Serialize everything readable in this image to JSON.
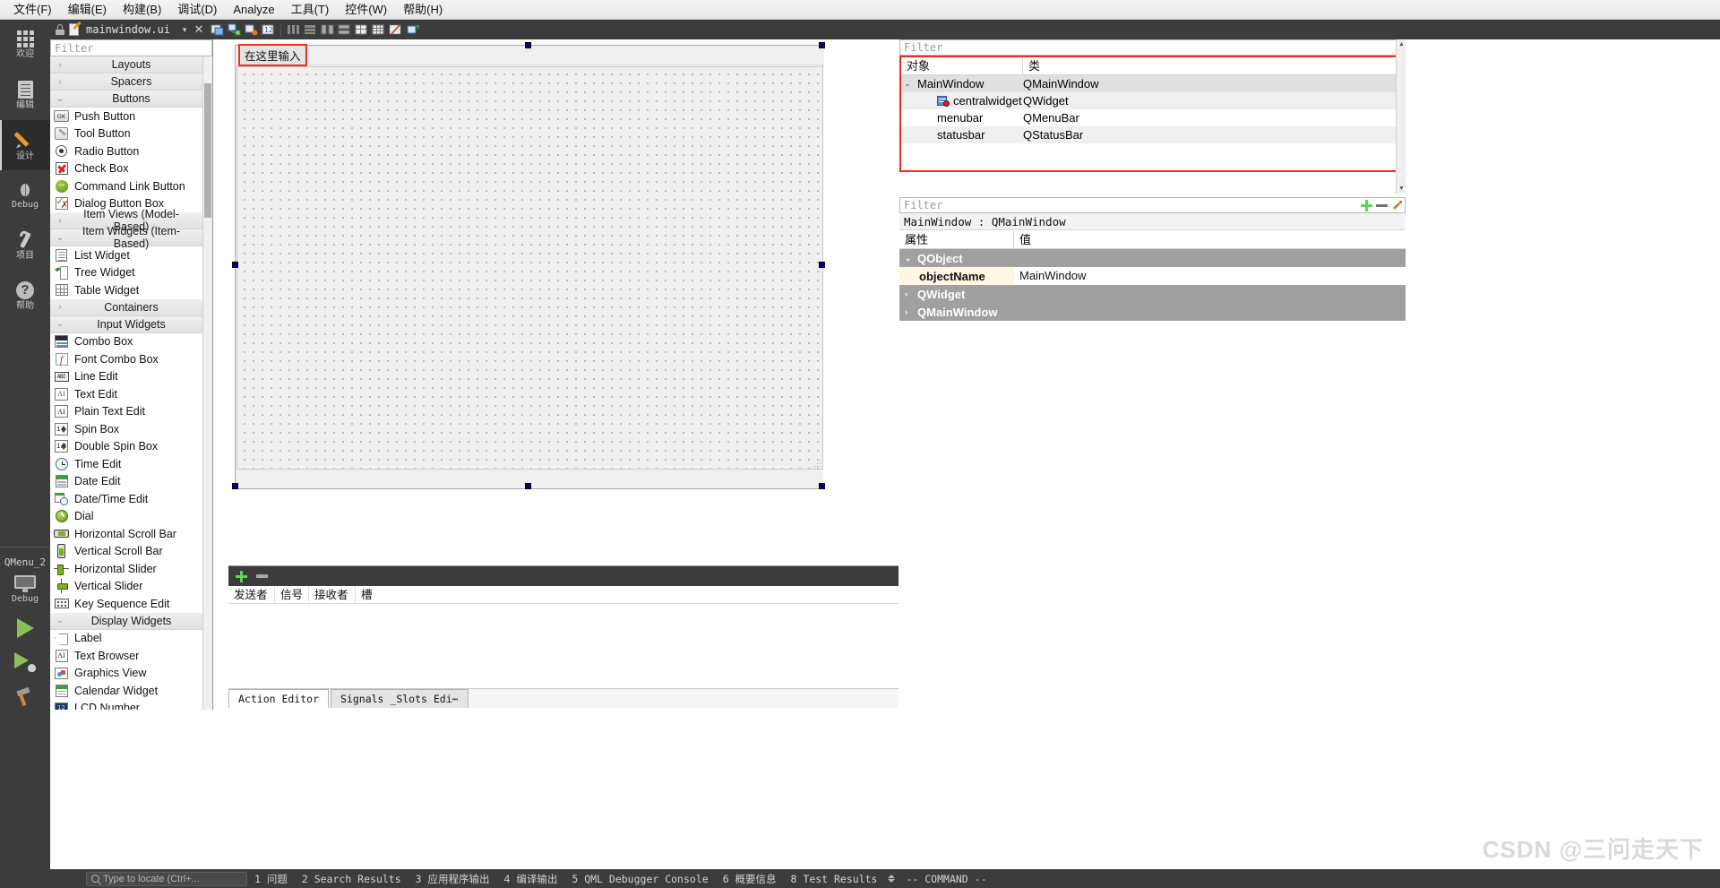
{
  "menubar": {
    "items": [
      "文件(F)",
      "编辑(E)",
      "构建(B)",
      "调试(D)",
      "Analyze",
      "工具(T)",
      "控件(W)",
      "帮助(H)"
    ]
  },
  "modebar": {
    "items": [
      {
        "label": "欢迎",
        "icon": "grid-icon"
      },
      {
        "label": "编辑",
        "icon": "document-icon"
      },
      {
        "label": "设计",
        "icon": "pencil-icon"
      },
      {
        "label": "Debug",
        "icon": "bug-icon"
      },
      {
        "label": "项目",
        "icon": "wrench-icon"
      },
      {
        "label": "帮助",
        "icon": "question-icon"
      }
    ],
    "kit_label": "QMenu_2",
    "run_config_label": "Debug"
  },
  "editor_toolbar": {
    "filename": "mainwindow.ui",
    "close_label": "✕",
    "dropdown_label": "▾"
  },
  "widgetbox": {
    "filter_placeholder": "Filter",
    "groups": [
      {
        "name": "Layouts",
        "expanded": false,
        "items": []
      },
      {
        "name": "Spacers",
        "expanded": false,
        "items": []
      },
      {
        "name": "Buttons",
        "expanded": true,
        "items": [
          {
            "label": "Push Button",
            "icon": "push-button-icon"
          },
          {
            "label": "Tool Button",
            "icon": "tool-button-icon"
          },
          {
            "label": "Radio Button",
            "icon": "radio-button-icon"
          },
          {
            "label": "Check Box",
            "icon": "check-box-icon"
          },
          {
            "label": "Command Link Button",
            "icon": "command-link-icon"
          },
          {
            "label": "Dialog Button Box",
            "icon": "dialog-button-box-icon"
          }
        ]
      },
      {
        "name": "Item Views (Model-Based)",
        "expanded": false,
        "items": []
      },
      {
        "name": "Item Widgets (Item-Based)",
        "expanded": true,
        "items": [
          {
            "label": "List Widget",
            "icon": "list-widget-icon"
          },
          {
            "label": "Tree Widget",
            "icon": "tree-widget-icon"
          },
          {
            "label": "Table Widget",
            "icon": "table-widget-icon"
          }
        ]
      },
      {
        "name": "Containers",
        "expanded": false,
        "items": []
      },
      {
        "name": "Input Widgets",
        "expanded": true,
        "items": [
          {
            "label": "Combo Box",
            "icon": "combo-box-icon"
          },
          {
            "label": "Font Combo Box",
            "icon": "font-combo-box-icon"
          },
          {
            "label": "Line Edit",
            "icon": "line-edit-icon"
          },
          {
            "label": "Text Edit",
            "icon": "text-edit-icon"
          },
          {
            "label": "Plain Text Edit",
            "icon": "plain-text-edit-icon"
          },
          {
            "label": "Spin Box",
            "icon": "spin-box-icon"
          },
          {
            "label": "Double Spin Box",
            "icon": "double-spin-box-icon"
          },
          {
            "label": "Time Edit",
            "icon": "time-edit-icon"
          },
          {
            "label": "Date Edit",
            "icon": "date-edit-icon"
          },
          {
            "label": "Date/Time Edit",
            "icon": "date-time-edit-icon"
          },
          {
            "label": "Dial",
            "icon": "dial-icon"
          },
          {
            "label": "Horizontal Scroll Bar",
            "icon": "horizontal-scroll-bar-icon"
          },
          {
            "label": "Vertical Scroll Bar",
            "icon": "vertical-scroll-bar-icon"
          },
          {
            "label": "Horizontal Slider",
            "icon": "horizontal-slider-icon"
          },
          {
            "label": "Vertical Slider",
            "icon": "vertical-slider-icon"
          },
          {
            "label": "Key Sequence Edit",
            "icon": "key-sequence-edit-icon"
          }
        ]
      },
      {
        "name": "Display Widgets",
        "expanded": true,
        "items": [
          {
            "label": "Label",
            "icon": "label-icon"
          },
          {
            "label": "Text Browser",
            "icon": "text-browser-icon"
          },
          {
            "label": "Graphics View",
            "icon": "graphics-view-icon"
          },
          {
            "label": "Calendar Widget",
            "icon": "calendar-widget-icon"
          },
          {
            "label": "LCD Number",
            "icon": "lcd-number-icon"
          }
        ]
      }
    ]
  },
  "form": {
    "menu_placeholder": "在这里输入"
  },
  "signal_slot_editor": {
    "columns": [
      "发送者",
      "信号",
      "接收者",
      "槽"
    ],
    "add_label": "+",
    "remove_label": "−"
  },
  "bottom_tabs": [
    {
      "label": "Action Editor",
      "active": true
    },
    {
      "label": "Signals _Slots Edi⋯",
      "active": false
    }
  ],
  "object_inspector": {
    "filter_placeholder": "Filter",
    "columns": [
      "对象",
      "类"
    ],
    "rows": [
      {
        "name": "MainWindow",
        "class": "QMainWindow",
        "depth": 0,
        "expander": "⌄",
        "selected": true,
        "icon": ""
      },
      {
        "name": "centralwidget",
        "class": "QWidget",
        "depth": 1,
        "expander": "",
        "selected": false,
        "icon": "widget-icon"
      },
      {
        "name": "menubar",
        "class": "QMenuBar",
        "depth": 1,
        "expander": "",
        "selected": false,
        "icon": ""
      },
      {
        "name": "statusbar",
        "class": "QStatusBar",
        "depth": 1,
        "expander": "",
        "selected": false,
        "icon": ""
      }
    ]
  },
  "property_editor": {
    "filter_placeholder": "Filter",
    "object_line": "MainWindow : QMainWindow",
    "columns": [
      "属性",
      "值"
    ],
    "groups": [
      {
        "name": "QObject",
        "expander": "⌄",
        "rows": [
          {
            "key": "objectName",
            "value": "MainWindow"
          }
        ]
      },
      {
        "name": "QWidget",
        "expander": "›",
        "rows": []
      },
      {
        "name": "QMainWindow",
        "expander": "›",
        "rows": []
      }
    ],
    "add_label": "+",
    "remove_label": "−",
    "config_label": "⚙"
  },
  "statusbar": {
    "locate_placeholder": "Type to locate (Ctrl+...",
    "items": [
      "1 问题",
      "2 Search Results",
      "3 应用程序输出",
      "4 编译输出",
      "5 QML Debugger Console",
      "6 概要信息",
      "8 Test Results"
    ],
    "command_label": "--  COMMAND  --"
  },
  "watermark": "CSDN @三问走天下",
  "colors": {
    "accent_orange": "#e8962d",
    "highlight_red": "#ef2d20",
    "dark_chrome": "#3c3c3c",
    "selected_row": "#e0e0e0",
    "property_row": "#fdf6e3"
  }
}
